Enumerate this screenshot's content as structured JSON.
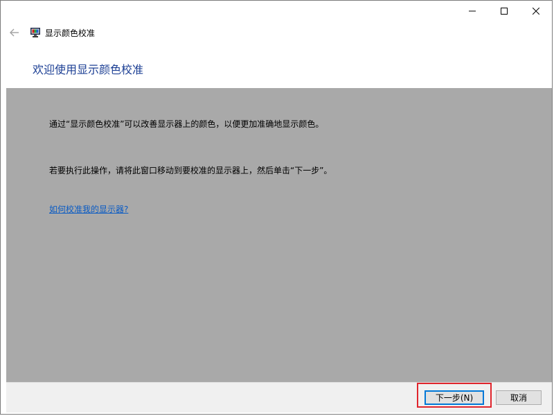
{
  "window": {
    "minimize_symbol": "—",
    "maximize_symbol": "☐",
    "close_symbol": "✕"
  },
  "nav": {
    "back_symbol": "←",
    "title": "显示颜色校准"
  },
  "header": {
    "title": "欢迎使用显示颜色校准"
  },
  "content": {
    "paragraph1": "通过“显示颜色校准”可以改善显示器上的颜色，以便更加准确地显示颜色。",
    "paragraph2": "若要执行此操作，请将此窗口移动到要校准的显示器上，然后单击“下一步”。",
    "help_link": "如何校准我的显示器?"
  },
  "footer": {
    "next_label": "下一步(N)",
    "cancel_label": "取消"
  },
  "colors": {
    "header_title": "#1c3f94",
    "content_bg": "#a9a9a9",
    "link": "#0a5bc4",
    "highlight": "#e0242c",
    "focus": "#0078d7"
  },
  "icons": {
    "app": "monitor-icon",
    "back": "back-arrow-icon",
    "minimize": "minimize-icon",
    "maximize": "maximize-icon",
    "close": "close-icon"
  }
}
